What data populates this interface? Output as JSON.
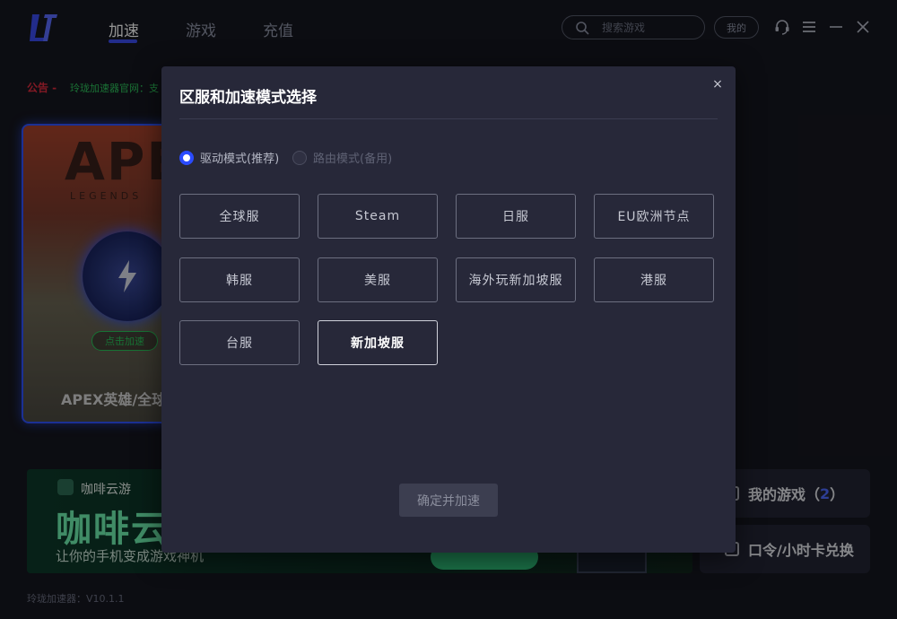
{
  "app": {
    "version": "玲珑加速器：V10.1.1"
  },
  "nav": {
    "items": [
      {
        "label": "加速"
      },
      {
        "label": "游戏"
      },
      {
        "label": "充值"
      }
    ]
  },
  "header": {
    "search_placeholder": "搜索游戏",
    "mine_label": "我的"
  },
  "notice": {
    "label": "公告 -",
    "text": "玲珑加速器官网：支"
  },
  "game_card": {
    "art_title": "APEX",
    "art_subtitle": "LEGENDS",
    "boost_label": "点击加速",
    "name": "APEX英雄/全球"
  },
  "banner": {
    "brand": "咖啡云游",
    "headline": "咖啡云",
    "slogan": "让你的手机变成游戏神机"
  },
  "side": {
    "my_games_label": "我的游戏（",
    "my_games_count": "2",
    "my_games_suffix": "）",
    "redeem_label": "口令/小时卡兑换"
  },
  "modal": {
    "title": "区服和加速模式选择",
    "close": "×",
    "modes": [
      {
        "label": "驱动模式(推荐)",
        "selected": true
      },
      {
        "label": "路由模式(备用)",
        "selected": false
      }
    ],
    "regions": [
      {
        "label": "全球服",
        "selected": false
      },
      {
        "label": "Steam",
        "selected": false
      },
      {
        "label": "日服",
        "selected": false
      },
      {
        "label": "EU欧洲节点",
        "selected": false
      },
      {
        "label": "韩服",
        "selected": false
      },
      {
        "label": "美服",
        "selected": false
      },
      {
        "label": "海外玩新加坡服",
        "selected": false
      },
      {
        "label": "港服",
        "selected": false
      },
      {
        "label": "台服",
        "selected": false
      },
      {
        "label": "新加坡服",
        "selected": true
      }
    ],
    "confirm_label": "确定并加速"
  },
  "colors": {
    "accent": "#2a4bff",
    "notice_red": "#e02c3e",
    "notice_green": "#2ec45c",
    "modal_bg": "#272839",
    "app_bg": "#16171f"
  }
}
